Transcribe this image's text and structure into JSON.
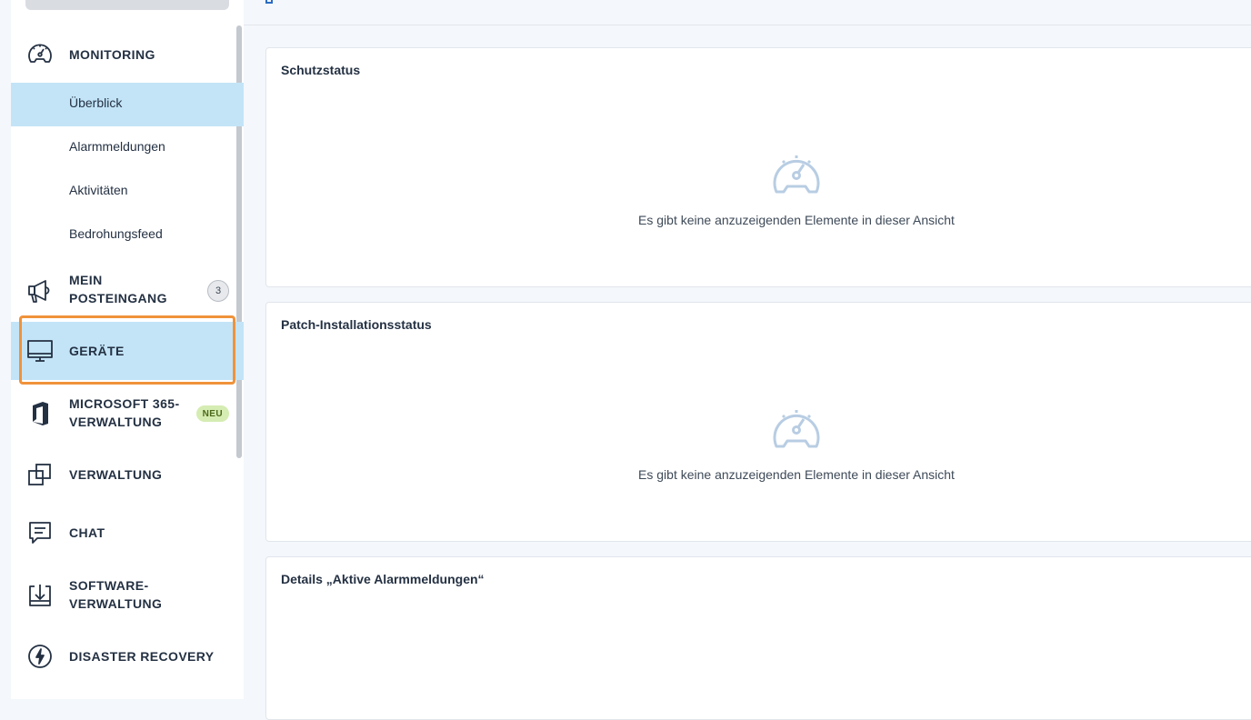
{
  "sidebar": {
    "monitoring": {
      "label": "MONITORING",
      "items": [
        "Überblick",
        "Alarmmeldungen",
        "Aktivitäten",
        "Bedrohungsfeed"
      ]
    },
    "inbox": {
      "label_line1": "MEIN",
      "label_line2": "POSTEINGANG",
      "count": "3"
    },
    "devices": {
      "label": "GERÄTE"
    },
    "m365": {
      "label_line1": "MICROSOFT 365-",
      "label_line2": "VERWALTUNG",
      "badge": "NEU"
    },
    "management": {
      "label": "VERWALTUNG"
    },
    "chat": {
      "label": "CHAT"
    },
    "software": {
      "label_line1": "SOFTWARE-",
      "label_line2": "VERWALTUNG"
    },
    "disaster": {
      "label": "DISASTER RECOVERY"
    }
  },
  "cards": [
    {
      "title": "Schutzstatus",
      "empty_message": "Es gibt keine anzuzeigenden Elemente in dieser Ansicht"
    },
    {
      "title": "Patch-Installationsstatus",
      "empty_message": "Es gibt keine anzuzeigenden Elemente in dieser Ansicht"
    },
    {
      "title": "Details „Aktive Alarmmeldungen“"
    }
  ],
  "colors": {
    "active_background": "#c3e4f7",
    "highlight_border": "#f0923a",
    "new_badge": "#d5ecb2",
    "empty_icon": "#b8cde3"
  },
  "icons": {
    "monitoring": "speedometer-icon",
    "inbox": "megaphone-icon",
    "devices": "monitor-icon",
    "m365": "office-logo-icon",
    "management": "overlapping-squares-icon",
    "chat": "chat-bubble-icon",
    "software": "download-tray-icon",
    "disaster": "lightning-circle-icon",
    "empty_state": "speedometer-icon"
  }
}
